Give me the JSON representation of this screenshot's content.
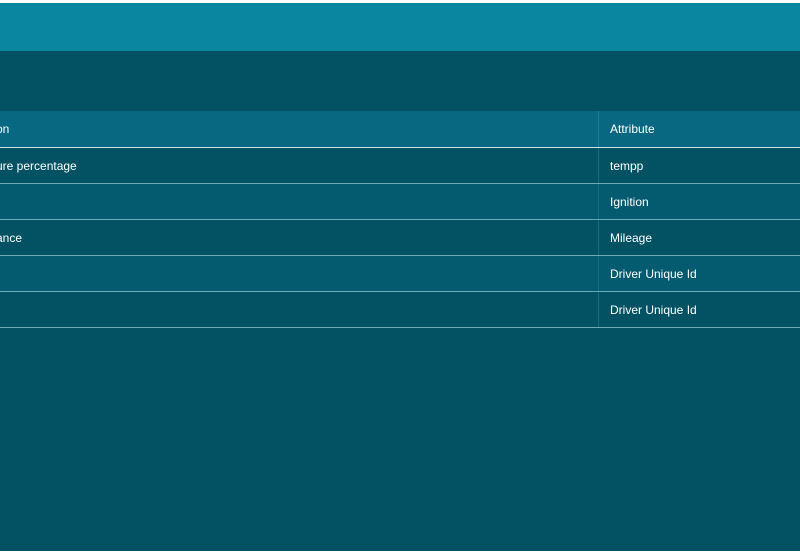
{
  "table": {
    "headers": {
      "description": "on",
      "attribute": "Attribute"
    },
    "rows": [
      {
        "description": "ure percentage",
        "attribute": "tempp"
      },
      {
        "description": "",
        "attribute": "Ignition"
      },
      {
        "description": "ance",
        "attribute": "Mileage"
      },
      {
        "description": "",
        "attribute": "Driver Unique Id"
      },
      {
        "description": "",
        "attribute": "Driver Unique Id"
      }
    ]
  },
  "colors": {
    "title_bar": "#0a86a1",
    "panel": "#035264",
    "header_row": "#096881",
    "text": "#ffffff"
  }
}
